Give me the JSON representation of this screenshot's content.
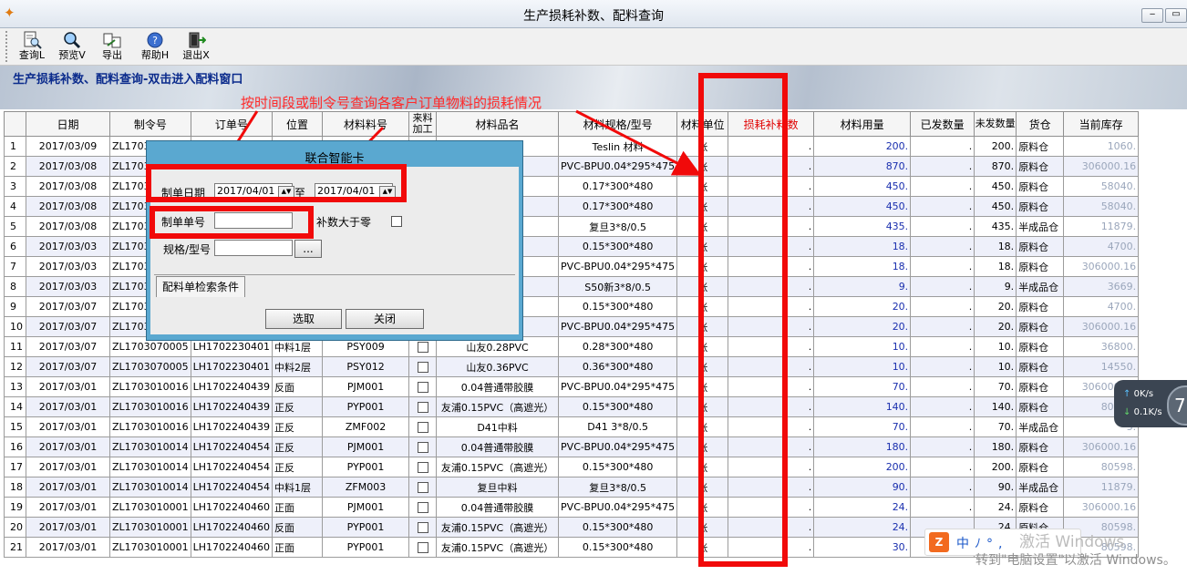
{
  "window": {
    "title": "生产损耗补数、配料查询",
    "minimize": "‒",
    "restore": "▭"
  },
  "toolbar": {
    "buttons": [
      {
        "label": "查询L",
        "icon": "document-search-icon"
      },
      {
        "label": "预览V",
        "icon": "magnifier-icon"
      },
      {
        "label": "导出",
        "icon": "export-icon"
      },
      {
        "label": "帮助H",
        "icon": "help-icon"
      },
      {
        "label": "退出X",
        "icon": "exit-door-icon"
      }
    ]
  },
  "banner": {
    "title": "生产损耗补数、配料查询-双击进入配料窗口",
    "annotation": "按时间段或制令号查询各客户订单物料的损耗情况"
  },
  "table": {
    "headers": [
      "",
      "日期",
      "制令号",
      "订单号",
      "位置",
      "材料料号",
      "来料加工",
      "材料品名",
      "材料规格/型号",
      "材料单位",
      "损耗补料数",
      "材料用量",
      "已发数量",
      "未发数量",
      "货仓",
      "当前库存"
    ],
    "rows": [
      [
        "1",
        "2017/03/09",
        "ZL1703",
        "",
        "",
        "",
        "",
        "",
        "Teslin 材料",
        "张",
        ".",
        "200.",
        ".",
        "200.",
        "原料仓",
        "1060."
      ],
      [
        "2",
        "2017/03/08",
        "ZL1703",
        "",
        "",
        "",
        "",
        "",
        "PVC-BPU0.04*295*475",
        "张",
        ".",
        "870.",
        ".",
        "870.",
        "原料仓",
        "306000.16"
      ],
      [
        "3",
        "2017/03/08",
        "ZL1703",
        "",
        "",
        "",
        "",
        "C",
        "0.17*300*480",
        "张",
        ".",
        "450.",
        ".",
        "450.",
        "原料仓",
        "58040."
      ],
      [
        "4",
        "2017/03/08",
        "ZL1703",
        "",
        "",
        "",
        "",
        "C",
        "0.17*300*480",
        "张",
        ".",
        "450.",
        ".",
        "450.",
        "原料仓",
        "58040."
      ],
      [
        "5",
        "2017/03/08",
        "ZL1703",
        "",
        "",
        "",
        "",
        "",
        "复旦3*8/0.5",
        "张",
        ".",
        "435.",
        ".",
        "435.",
        "半成品仓",
        "11879."
      ],
      [
        "6",
        "2017/03/03",
        "ZL1703",
        "",
        "",
        "",
        "",
        "白色",
        "0.15*300*480",
        "张",
        ".",
        "18.",
        ".",
        "18.",
        "原料仓",
        "4700."
      ],
      [
        "7",
        "2017/03/03",
        "ZL1703",
        "",
        "",
        "",
        "",
        "",
        "PVC-BPU0.04*295*475",
        "张",
        ".",
        "18.",
        ".",
        "18.",
        "原料仓",
        "306000.16"
      ],
      [
        "8",
        "2017/03/03",
        "ZL1703",
        "",
        "",
        "",
        "",
        "",
        "S50新3*8/0.5",
        "张",
        ".",
        "9.",
        ".",
        "9.",
        "半成品仓",
        "3669."
      ],
      [
        "9",
        "2017/03/07",
        "ZL1703",
        "",
        "",
        "",
        "",
        "白色",
        "0.15*300*480",
        "张",
        ".",
        "20.",
        ".",
        "20.",
        "原料仓",
        "4700."
      ],
      [
        "10",
        "2017/03/07",
        "ZL1703",
        "",
        "",
        "",
        "",
        "",
        "PVC-BPU0.04*295*475",
        "张",
        ".",
        "20.",
        ".",
        "20.",
        "原料仓",
        "306000.16"
      ],
      [
        "11",
        "2017/03/07",
        "ZL1703070005",
        "LH1702230401",
        "中料1层",
        "PSY009",
        "☐",
        "山友0.28PVC",
        "0.28*300*480",
        "张",
        ".",
        "10.",
        ".",
        "10.",
        "原料仓",
        "36800."
      ],
      [
        "12",
        "2017/03/07",
        "ZL1703070005",
        "LH1702230401",
        "中料2层",
        "PSY012",
        "☐",
        "山友0.36PVC",
        "0.36*300*480",
        "张",
        ".",
        "10.",
        ".",
        "10.",
        "原料仓",
        "14550."
      ],
      [
        "13",
        "2017/03/01",
        "ZL1703010016",
        "LH1702240439",
        "反面",
        "PJM001",
        "☐",
        "0.04普通带胶膜",
        "PVC-BPU0.04*295*475",
        "张",
        ".",
        "70.",
        ".",
        "70.",
        "原料仓",
        "306000.16"
      ],
      [
        "14",
        "2017/03/01",
        "ZL1703010016",
        "LH1702240439",
        "正反",
        "PYP001",
        "☐",
        "友浦0.15PVC（高遮光）",
        "0.15*300*480",
        "张",
        ".",
        "140.",
        ".",
        "140.",
        "原料仓",
        "80598."
      ],
      [
        "15",
        "2017/03/01",
        "ZL1703010016",
        "LH1702240439",
        "正反",
        "ZMF002",
        "☐",
        "D41中料",
        "D41 3*8/0.5",
        "张",
        ".",
        "70.",
        ".",
        "70.",
        "半成品仓",
        "5."
      ],
      [
        "16",
        "2017/03/01",
        "ZL1703010014",
        "LH1702240454",
        "正反",
        "PJM001",
        "☐",
        "0.04普通带胶膜",
        "PVC-BPU0.04*295*475",
        "张",
        ".",
        "180.",
        ".",
        "180.",
        "原料仓",
        "306000.16"
      ],
      [
        "17",
        "2017/03/01",
        "ZL1703010014",
        "LH1702240454",
        "正反",
        "PYP001",
        "☐",
        "友浦0.15PVC（高遮光）",
        "0.15*300*480",
        "张",
        ".",
        "200.",
        ".",
        "200.",
        "原料仓",
        "80598."
      ],
      [
        "18",
        "2017/03/01",
        "ZL1703010014",
        "LH1702240454",
        "中料1层",
        "ZFM003",
        "☐",
        "复旦中料",
        "复旦3*8/0.5",
        "张",
        ".",
        "90.",
        ".",
        "90.",
        "半成品仓",
        "11879."
      ],
      [
        "19",
        "2017/03/01",
        "ZL1703010001",
        "LH1702240460",
        "正面",
        "PJM001",
        "☐",
        "0.04普通带胶膜",
        "PVC-BPU0.04*295*475",
        "张",
        ".",
        "24.",
        ".",
        "24.",
        "原料仓",
        "306000.16"
      ],
      [
        "20",
        "2017/03/01",
        "ZL1703010001",
        "LH1702240460",
        "反面",
        "PYP001",
        "☐",
        "友浦0.15PVC（高遮光）",
        "0.15*300*480",
        "张",
        ".",
        "24.",
        ".",
        "24.",
        "原料仓",
        "80598."
      ],
      [
        "21",
        "2017/03/01",
        "ZL1703010001",
        "LH1702240460",
        "正面",
        "PYP001",
        "☐",
        "友浦0.15PVC（高遮光）",
        "0.15*300*480",
        "张",
        ".",
        "30.",
        ".",
        "30.",
        "原料仓",
        "80598."
      ]
    ]
  },
  "dialog": {
    "title": "联合智能卡",
    "date_label": "制单日期",
    "date_from": "2017/04/01",
    "date_to_label": "至",
    "date_to": "2017/04/01",
    "order_label": "制单单号",
    "order_value": "",
    "positive_label": "补数大于零",
    "spec_label": "规格/型号",
    "spec_value": "",
    "browse_label": "...",
    "tab_label": "配料单检索条件",
    "select_button": "选取",
    "close_button": "关闭"
  },
  "network": {
    "up": "0K/s",
    "down": "0.1K/s",
    "percent": "7"
  },
  "ime": {
    "logo": "Z",
    "chars": "中ﾉ°,"
  },
  "watermark": {
    "line1": "激活 Windows",
    "line2": "转到\"电脑设置\"以激活 Windows。"
  }
}
